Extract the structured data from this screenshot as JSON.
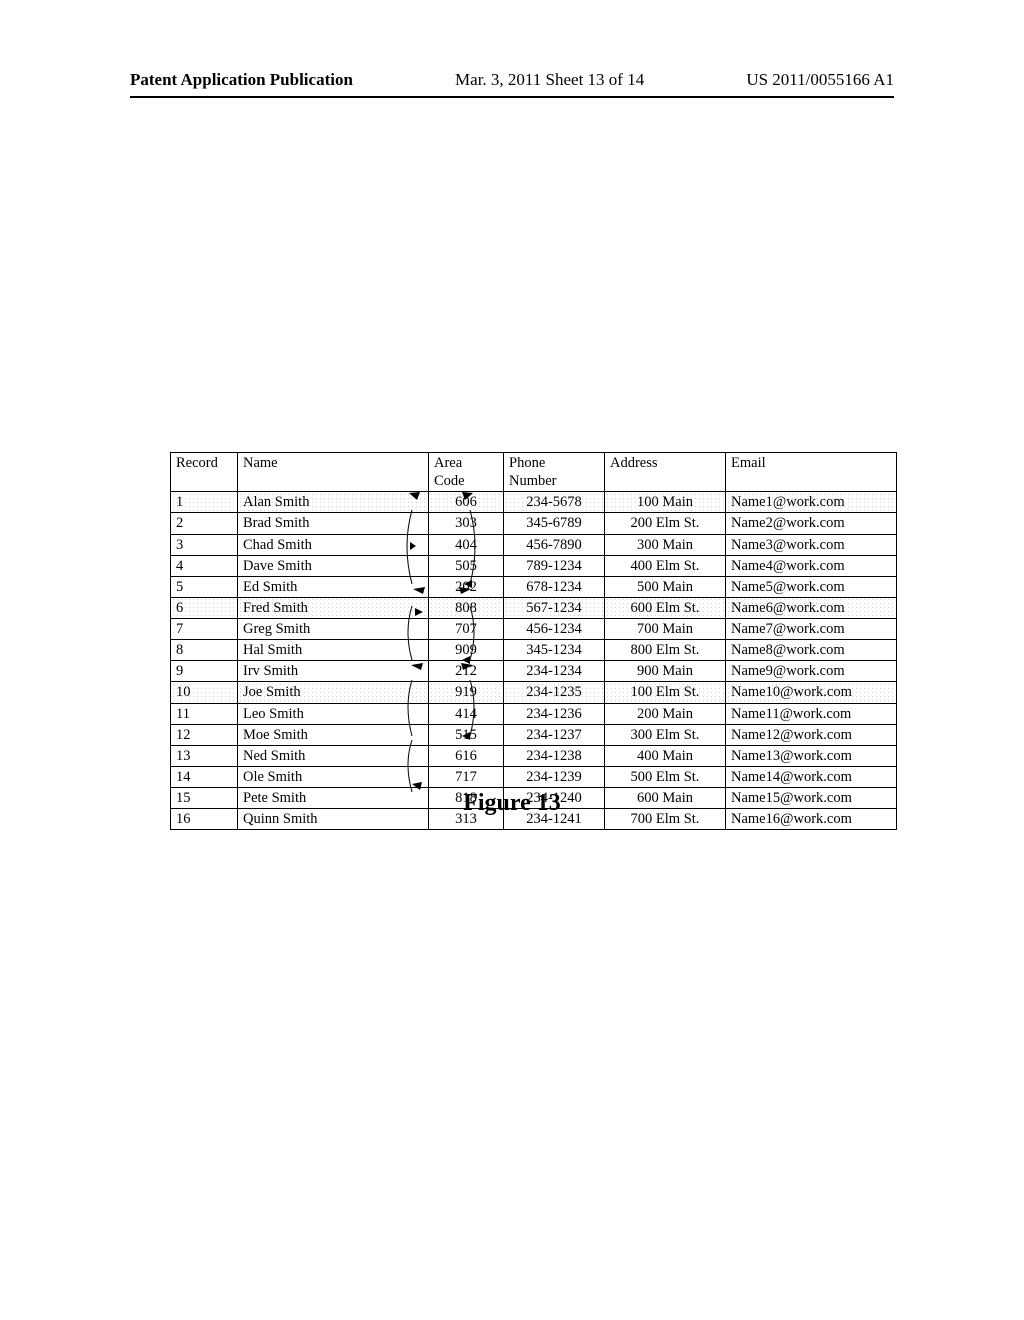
{
  "header": {
    "left": "Patent Application Publication",
    "center": "Mar. 3, 2011  Sheet 13 of 14",
    "right": "US 2011/0055166 A1"
  },
  "table": {
    "columns": {
      "record": "Record",
      "name": "Name",
      "area_l1": "Area",
      "area_l2": "Code",
      "phone_l1": "Phone",
      "phone_l2": "Number",
      "address": "Address",
      "email": "Email"
    },
    "rows": [
      {
        "record": "1",
        "name": "Alan Smith",
        "area": "606",
        "phone": "234-5678",
        "address": "100 Main",
        "email": "Name1@work.com",
        "hl": true
      },
      {
        "record": "2",
        "name": "Brad Smith",
        "area": "303",
        "phone": "345-6789",
        "address": "200 Elm St.",
        "email": "Name2@work.com",
        "hl": false
      },
      {
        "record": "3",
        "name": "Chad Smith",
        "area": "404",
        "phone": "456-7890",
        "address": "300 Main",
        "email": "Name3@work.com",
        "hl": false
      },
      {
        "record": "4",
        "name": "Dave Smith",
        "area": "505",
        "phone": "789-1234",
        "address": "400 Elm St.",
        "email": "Name4@work.com",
        "hl": false
      },
      {
        "record": "5",
        "name": "Ed Smith",
        "area": "202",
        "phone": "678-1234",
        "address": "500 Main",
        "email": "Name5@work.com",
        "hl": false
      },
      {
        "record": "6",
        "name": "Fred Smith",
        "area": "808",
        "phone": "567-1234",
        "address": "600 Elm St.",
        "email": "Name6@work.com",
        "hl": true
      },
      {
        "record": "7",
        "name": "Greg Smith",
        "area": "707",
        "phone": "456-1234",
        "address": "700 Main",
        "email": "Name7@work.com",
        "hl": false
      },
      {
        "record": "8",
        "name": "Hal Smith",
        "area": "909",
        "phone": "345-1234",
        "address": "800 Elm St.",
        "email": "Name8@work.com",
        "hl": false
      },
      {
        "record": "9",
        "name": "Irv Smith",
        "area": "212",
        "phone": "234-1234",
        "address": "900 Main",
        "email": "Name9@work.com",
        "hl": false
      },
      {
        "record": "10",
        "name": "Joe Smith",
        "area": "919",
        "phone": "234-1235",
        "address": "100 Elm St.",
        "email": "Name10@work.com",
        "hl": true
      },
      {
        "record": "11",
        "name": "Leo Smith",
        "area": "414",
        "phone": "234-1236",
        "address": "200 Main",
        "email": "Name11@work.com",
        "hl": false
      },
      {
        "record": "12",
        "name": "Moe Smith",
        "area": "515",
        "phone": "234-1237",
        "address": "300 Elm St.",
        "email": "Name12@work.com",
        "hl": false
      },
      {
        "record": "13",
        "name": "Ned Smith",
        "area": "616",
        "phone": "234-1238",
        "address": "400 Main",
        "email": "Name13@work.com",
        "hl": false
      },
      {
        "record": "14",
        "name": "Ole Smith",
        "area": "717",
        "phone": "234-1239",
        "address": "500 Elm St.",
        "email": "Name14@work.com",
        "hl": false
      },
      {
        "record": "15",
        "name": "Pete Smith",
        "area": "818",
        "phone": "234-1240",
        "address": "600 Main",
        "email": "Name15@work.com",
        "hl": false
      },
      {
        "record": "16",
        "name": "Quinn Smith",
        "area": "313",
        "phone": "234-1241",
        "address": "700 Elm St.",
        "email": "Name16@work.com",
        "hl": false
      }
    ]
  },
  "caption": "Figure 13"
}
